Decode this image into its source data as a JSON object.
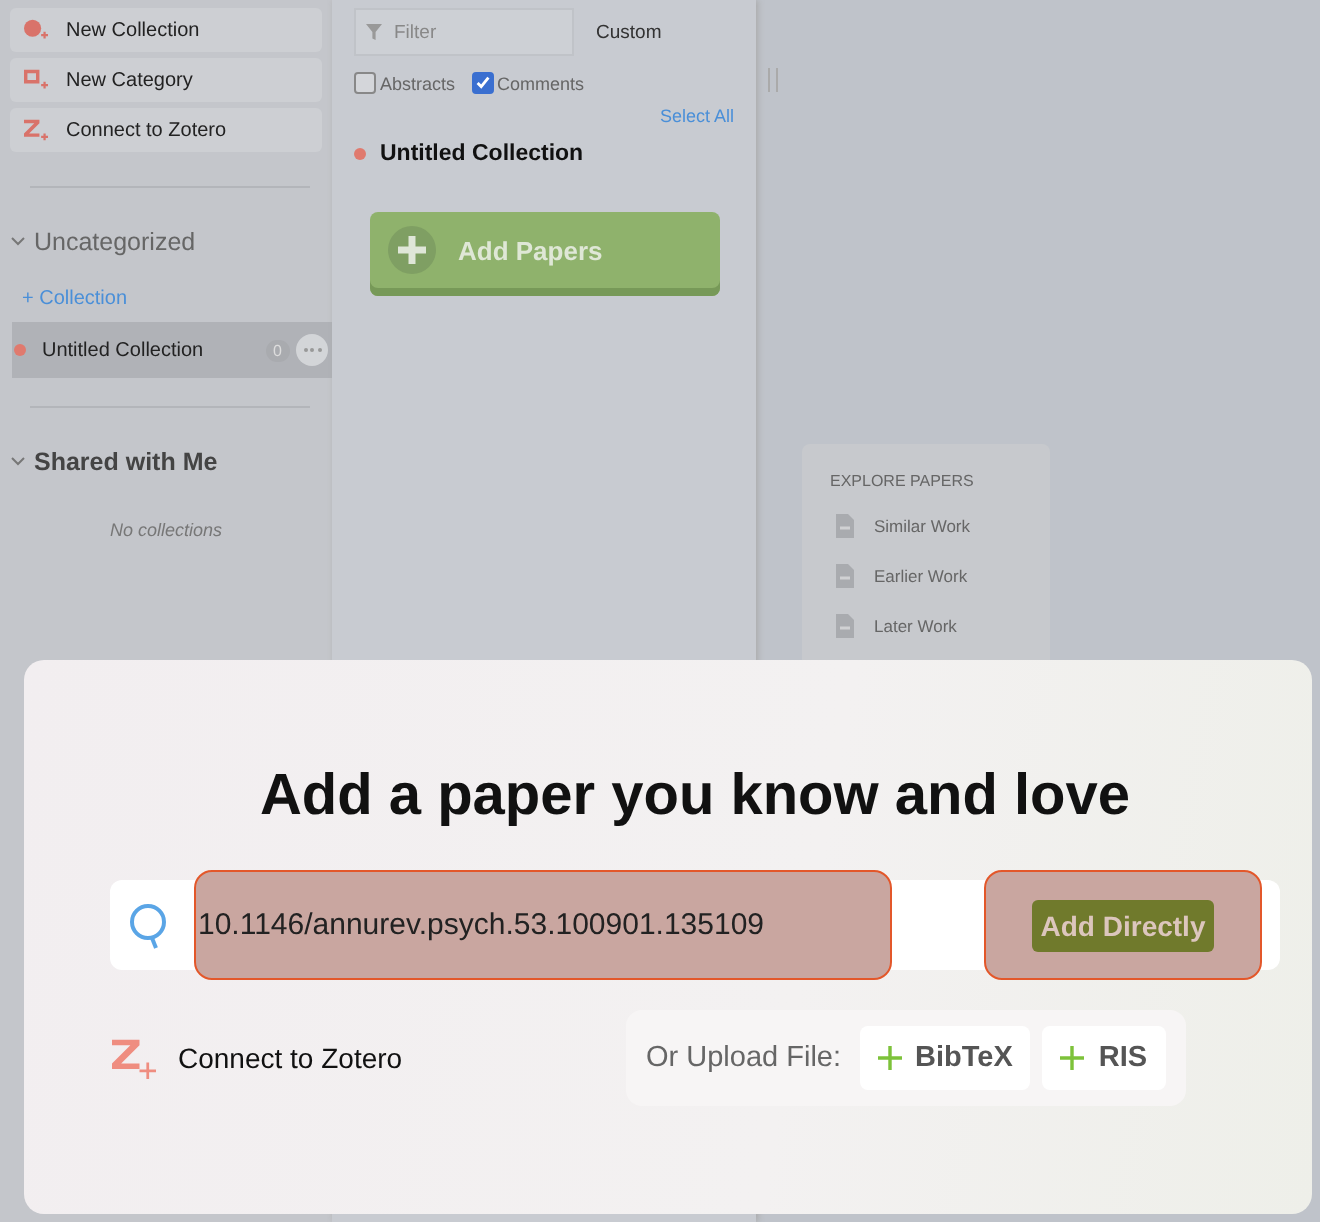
{
  "sidebar": {
    "actions": [
      {
        "label": "New Collection"
      },
      {
        "label": "New Category"
      },
      {
        "label": "Connect to Zotero"
      }
    ],
    "sections": [
      {
        "title": "Uncategorized",
        "emphasized": false,
        "expanded": true,
        "add_link": "+ Collection",
        "items": [
          {
            "name": "Untitled Collection",
            "color": "#e07a6e",
            "count": "0",
            "selected": true
          }
        ]
      },
      {
        "title": "Shared with Me",
        "emphasized": true,
        "expanded": true,
        "empty": "No collections"
      }
    ]
  },
  "papers": {
    "filter": {
      "placeholder": "Filter"
    },
    "sort": "Custom",
    "toggles": [
      {
        "label": "Abstracts",
        "checked": false
      },
      {
        "label": "Comments",
        "checked": true
      }
    ],
    "select_all": "Select All",
    "collection": {
      "name": "Untitled Collection",
      "color": "#e07a6e"
    },
    "add_button": "Add Papers"
  },
  "explore": {
    "title": "EXPLORE PAPERS",
    "items": [
      "Similar Work",
      "Earlier Work",
      "Later Work"
    ]
  },
  "dialog": {
    "title": "Add a paper you know and love",
    "search": {
      "value": "10.1146/annurev.psych.53.100901.135109",
      "highlighted": true
    },
    "add_button": {
      "label": "Add Directly",
      "highlighted": true
    },
    "connect": "Connect to Zotero",
    "upload": {
      "label": "Or Upload File:",
      "buttons": [
        "BibTeX",
        "RIS"
      ]
    }
  }
}
